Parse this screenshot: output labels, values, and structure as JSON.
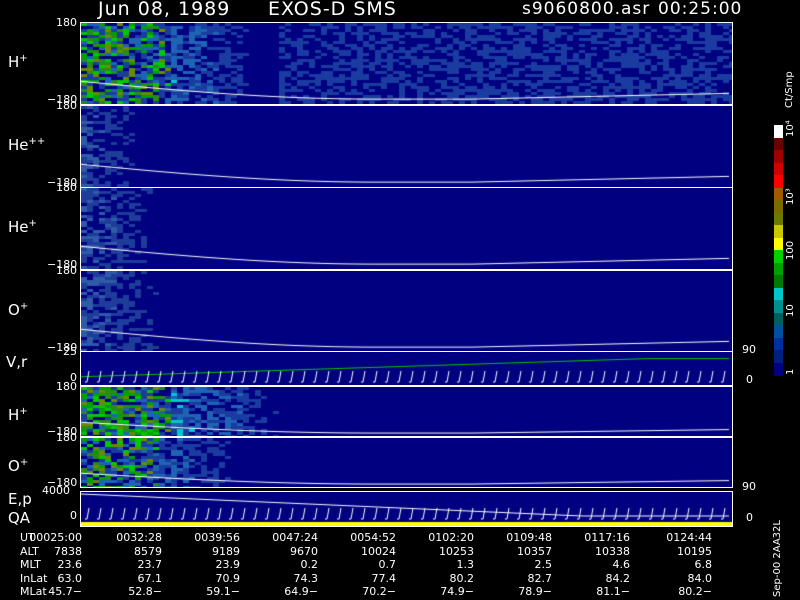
{
  "header": {
    "date": "Jun 08, 1989",
    "instrument": "EXOS-D SMS",
    "file": "s9060800.asr",
    "time": "00:25:00"
  },
  "panels": [
    {
      "id": "h_plus_1",
      "species": "H",
      "charge": "+",
      "ymax": "180",
      "ymin": "−180",
      "intensity": 0.85,
      "fade": 0.3,
      "color_type": "hplus"
    },
    {
      "id": "he_pp",
      "species": "He",
      "charge": "++",
      "ymax": "180",
      "ymin": "−180",
      "intensity": 0.35,
      "fade": 0.12,
      "color_type": "dim"
    },
    {
      "id": "he_p",
      "species": "He",
      "charge": "+",
      "ymax": "180",
      "ymin": "−180",
      "intensity": 0.4,
      "fade": 0.15,
      "color_type": "dim"
    },
    {
      "id": "o_plus_1",
      "species": "O",
      "charge": "+",
      "ymax": "180",
      "ymin": "−180",
      "intensity": 0.4,
      "fade": 0.17,
      "color_type": "dim"
    }
  ],
  "vr_panel": {
    "label": "V,r",
    "ymax": "25",
    "ymin": "0",
    "right_top": "90",
    "right_bottom": "0"
  },
  "lower_panels": [
    {
      "id": "h_plus_2",
      "species": "H",
      "charge": "+",
      "ymax": "180",
      "ymin": "−180",
      "intensity": 0.9,
      "fade": 0.35,
      "color_type": "hplus"
    },
    {
      "id": "o_plus_2",
      "species": "O",
      "charge": "+",
      "ymax": "180",
      "ymin": "−180",
      "intensity": 0.7,
      "fade": 0.28,
      "color_type": "hplus"
    }
  ],
  "ep_panel": {
    "label1": "E,p",
    "label2": "QA",
    "ymax": "4000",
    "ymin": "0",
    "right_top": "90",
    "right_bottom": "0"
  },
  "colorbar": {
    "unit": "Ct/Smp",
    "ticks": [
      {
        "label": "10⁴",
        "pos": 0.0
      },
      {
        "label": "10³",
        "pos": 0.27
      },
      {
        "label": "100",
        "pos": 0.49
      },
      {
        "label": "10",
        "pos": 0.72
      },
      {
        "label": "1",
        "pos": 0.95
      }
    ],
    "colors": [
      "#ffffff",
      "#6a0000",
      "#a00000",
      "#d00000",
      "#ff0000",
      "#a05a00",
      "#7a6a00",
      "#6a7a00",
      "#c8c800",
      "#ffff00",
      "#00d000",
      "#00a000",
      "#007a00",
      "#00c8c8",
      "#009090",
      "#006060",
      "#0050a0",
      "#0030a0",
      "#002080",
      "#000080"
    ]
  },
  "chart_data": {
    "type": "heatmap",
    "title": "Jun 08, 1989   EXOS-D SMS",
    "time_axis": {
      "labels": [
        "UT",
        "ALT",
        "MLT",
        "InLat",
        "MLat"
      ],
      "columns": [
        [
          "00025:00",
          "7838",
          "23.6",
          "63.0",
          "−45.7"
        ],
        [
          "0032:28",
          "8579",
          "23.7",
          "67.1",
          "−52.8"
        ],
        [
          "0039:56",
          "9189",
          "23.9",
          "70.9",
          "−59.1"
        ],
        [
          "0047:24",
          "9670",
          "0.2",
          "74.3",
          "−64.9"
        ],
        [
          "0054:52",
          "10024",
          "0.7",
          "77.4",
          "−70.2"
        ],
        [
          "0102:20",
          "10253",
          "1.3",
          "80.2",
          "−74.9"
        ],
        [
          "0109:48",
          "10357",
          "2.5",
          "82.7",
          "−78.9"
        ],
        [
          "0117:16",
          "10338",
          "4.6",
          "84.2",
          "−81.1"
        ],
        [
          "0124:44",
          "10195",
          "6.8",
          "84.0",
          "−80.2"
        ]
      ]
    },
    "side_note": "Sep-00 2AA32L"
  }
}
